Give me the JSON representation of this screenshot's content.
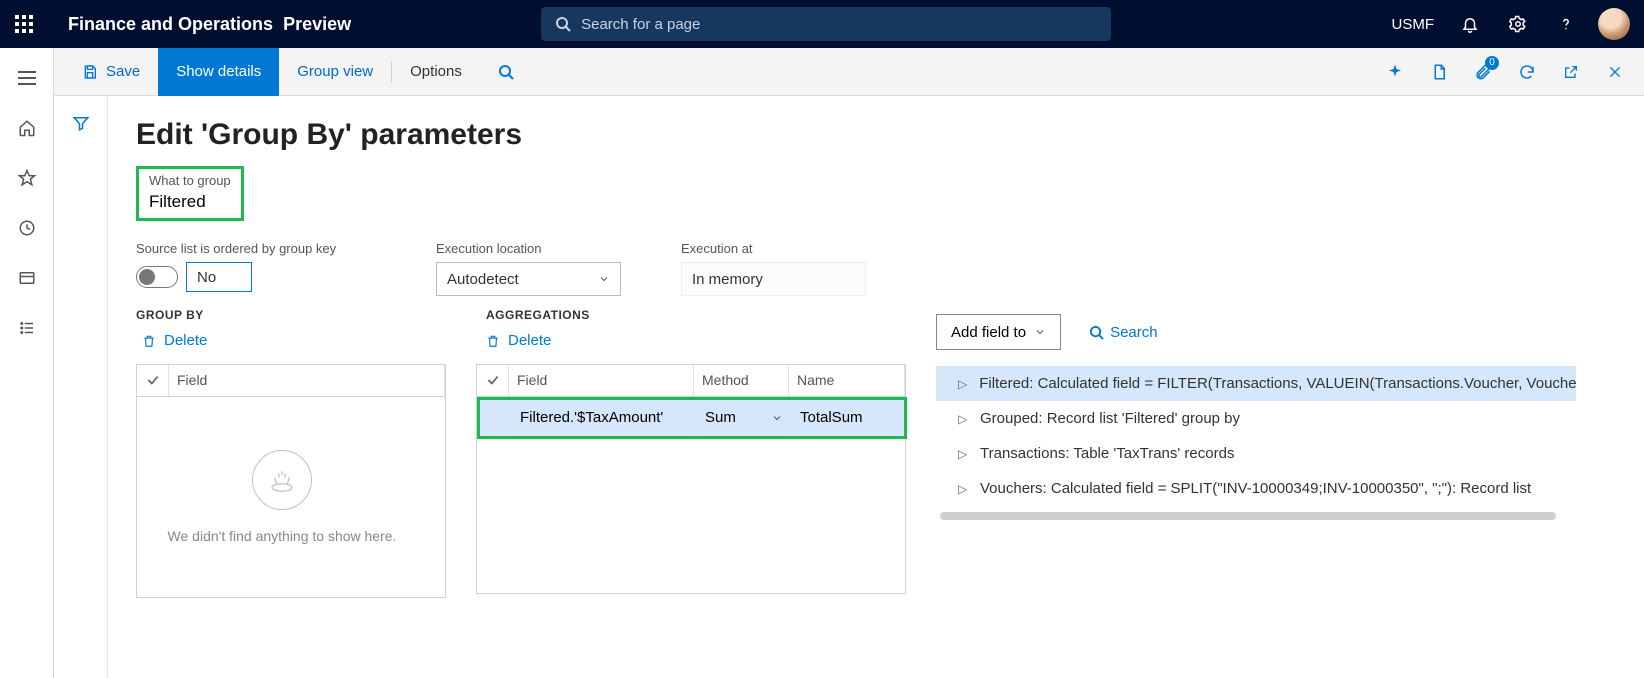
{
  "header": {
    "app_title": "Finance and Operations",
    "preview_label": "Preview",
    "search_placeholder": "Search for a page",
    "entity": "USMF"
  },
  "action_bar": {
    "save": "Save",
    "show_details": "Show details",
    "group_view": "Group view",
    "options": "Options",
    "attach_count": "0"
  },
  "page": {
    "title": "Edit 'Group By' parameters",
    "what_to_group_label": "What to group",
    "what_to_group_value": "Filtered",
    "ordered_label": "Source list is ordered by group key",
    "ordered_value": "No",
    "exec_location_label": "Execution location",
    "exec_location_value": "Autodetect",
    "exec_at_label": "Execution at",
    "exec_at_value": "In memory"
  },
  "groupby": {
    "title": "GROUP BY",
    "delete": "Delete",
    "field_header": "Field",
    "empty_msg": "We didn't find anything to show here."
  },
  "aggregations": {
    "title": "AGGREGATIONS",
    "delete": "Delete",
    "field_header": "Field",
    "method_header": "Method",
    "name_header": "Name",
    "rows": [
      {
        "field": "Filtered.'$TaxAmount'",
        "method": "Sum",
        "name": "TotalSum"
      }
    ]
  },
  "picker": {
    "add_field": "Add field to",
    "search": "Search",
    "items": [
      "Filtered: Calculated field = FILTER(Transactions, VALUEIN(Transactions.Voucher, Vouchers, Vouchers.Value))",
      "Grouped: Record list 'Filtered' group by",
      "Transactions: Table 'TaxTrans' records",
      "Vouchers: Calculated field = SPLIT(\"INV-10000349;INV-10000350\", \";\"): Record list"
    ]
  }
}
